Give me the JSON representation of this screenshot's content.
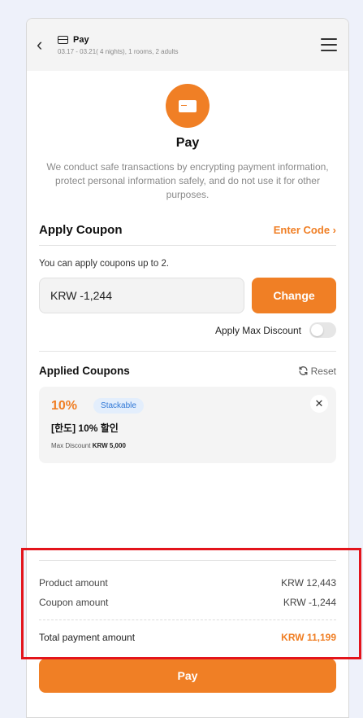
{
  "header": {
    "title": "Pay",
    "subtitle": "03.17 - 03.21( 4 nights), 1 rooms, 2 adults"
  },
  "hero": {
    "title": "Pay",
    "description": "We conduct safe transactions by encrypting payment information, protect personal information safely, and do not use it for other purposes."
  },
  "coupon": {
    "heading": "Apply Coupon",
    "enter_code": "Enter Code ›",
    "note": "You can apply coupons up to 2.",
    "value": "KRW  -1,244",
    "change_label": "Change",
    "max_discount_label": "Apply Max Discount"
  },
  "applied": {
    "heading": "Applied Coupons",
    "reset_label": "Reset",
    "card": {
      "percent": "10%",
      "badge": "Stackable",
      "name": "[한도] 10% 할인",
      "max_prefix": "Max Discount",
      "max_value": "KRW 5,000"
    }
  },
  "totals": {
    "product_label": "Product amount",
    "product_value": "KRW 12,443",
    "coupon_label": "Coupon amount",
    "coupon_value": "KRW -1,244",
    "total_label": "Total payment amount",
    "total_value": "KRW 11,199"
  },
  "pay_button": "Pay",
  "colors": {
    "accent": "#f07f25",
    "highlight": "#e3141b",
    "badge": "#2f77d6"
  }
}
